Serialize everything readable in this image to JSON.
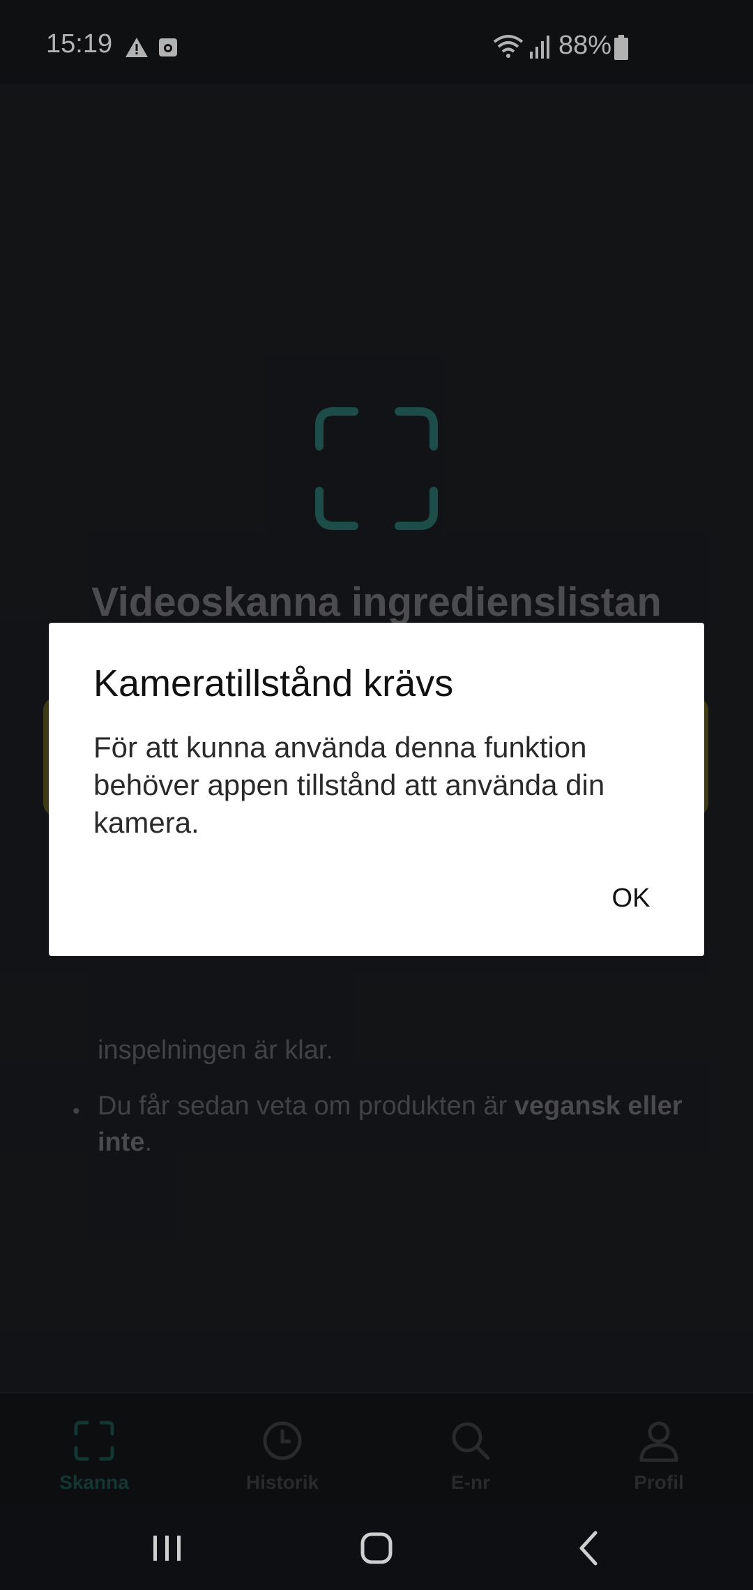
{
  "status_bar": {
    "time": "15:19",
    "battery": "88%",
    "icons": [
      "alert-icon",
      "camera-notification-icon",
      "wifi-icon",
      "signal-icon",
      "battery-icon"
    ]
  },
  "screen": {
    "title": "Videoskanna ingredienslistan",
    "instructions": {
      "line1": "inspelningen är klar.",
      "line2_prefix": "Du får sedan veta om produkten är ",
      "line2_bold": "vegansk eller inte",
      "line2_suffix": "."
    }
  },
  "bottom_nav": {
    "items": [
      {
        "label": "Skanna",
        "icon": "scan-icon",
        "active": true
      },
      {
        "label": "Historik",
        "icon": "clock-icon",
        "active": false
      },
      {
        "label": "E-nr",
        "icon": "search-icon",
        "active": false
      },
      {
        "label": "Profil",
        "icon": "person-icon",
        "active": false
      }
    ]
  },
  "dialog": {
    "title": "Kameratillstånd krävs",
    "message": "För att kunna använda denna funktion behöver appen tillstånd att använda din kamera.",
    "ok_label": "OK"
  },
  "colors": {
    "background": "#1b1c20",
    "accent_teal": "#2a6f68",
    "dialog_bg": "#ffffff"
  }
}
